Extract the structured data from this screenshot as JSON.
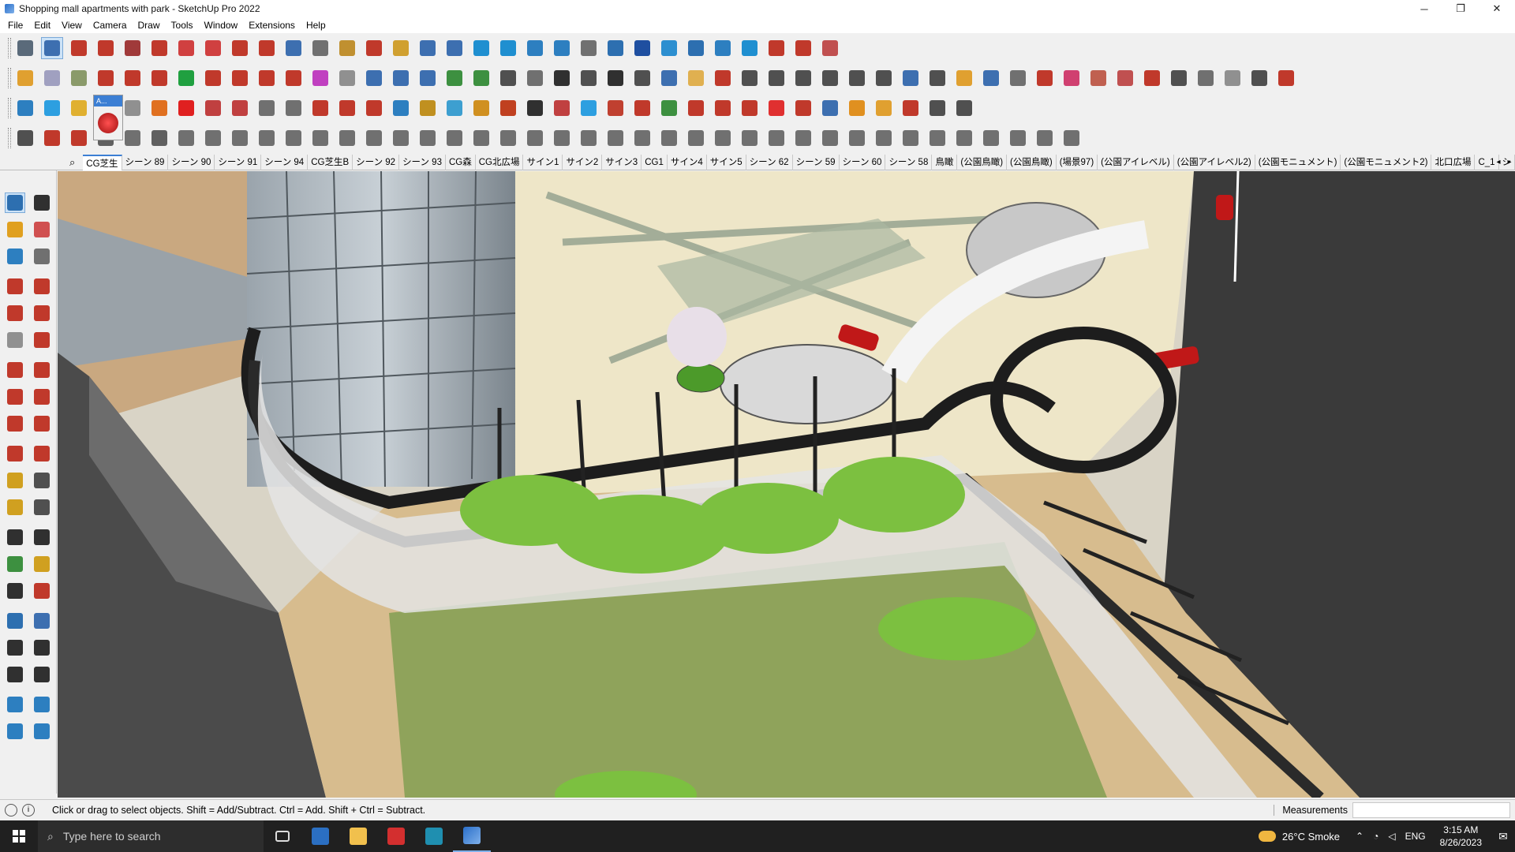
{
  "window": {
    "title": "Shopping mall apartments with park - SketchUp Pro 2022",
    "minimize": "─",
    "restore": "❐",
    "close": "✕"
  },
  "menu": [
    "File",
    "Edit",
    "View",
    "Camera",
    "Draw",
    "Tools",
    "Window",
    "Extensions",
    "Help"
  ],
  "toolbars": {
    "row1_colors": [
      "#5a6a7a",
      "#3d6fb0",
      "#c0392b",
      "#c0392b",
      "#a03a3a",
      "#c0392b",
      "#d04040",
      "#d04040",
      "#c0392b",
      "#c0392b",
      "#3d6fb0",
      "#707070",
      "#c09030",
      "#c0392b",
      "#d0a030",
      "#3d6fb0",
      "#3d6fb0",
      "#1f8fd0",
      "#1f8fd0",
      "#2d7fc0",
      "#2d7fc0",
      "#707070",
      "#2d6fb0",
      "#1f4fa0",
      "#2d8fd0",
      "#2d6fb0",
      "#2d7fc0",
      "#1f8fd0",
      "#c0392b",
      "#c0392b",
      "#c05050"
    ],
    "row2_colors": [
      "#e0a030",
      "#a0a0c0",
      "#8a9a6a",
      "#c0392b",
      "#c0392b",
      "#c0392b",
      "#20a040",
      "#c0392b",
      "#c0392b",
      "#c0392b",
      "#c0392b",
      "#c040c0",
      "#909090",
      "#3d6fb0",
      "#3d6fb0",
      "#3d6fb0",
      "#3d9040",
      "#3d9040",
      "#505050",
      "#707070",
      "#303030",
      "#505050",
      "#303030",
      "#505050",
      "#3d6fb0",
      "#e0b050",
      "#c0392b",
      "#505050",
      "#505050",
      "#505050",
      "#505050",
      "#505050",
      "#505050",
      "#3d6fb0",
      "#505050",
      "#e0a030",
      "#3d6fb0",
      "#707070",
      "#c0392b",
      "#d04070",
      "#c06050",
      "#c05050",
      "#c0392b",
      "#505050",
      "#707070",
      "#909090",
      "#505050",
      "#c0392b"
    ],
    "row3_colors": [
      "#2d7fc0",
      "#2d9fe0",
      "#e0b030",
      "#c0392b",
      "#909090",
      "#e07020",
      "#e02020",
      "#c04040",
      "#c04040",
      "#707070",
      "#707070",
      "#c0392b",
      "#c0392b",
      "#c0392b",
      "#2d7fc0",
      "#c09020",
      "#3d9fd0",
      "#d09020",
      "#c04020",
      "#303030",
      "#c04040",
      "#2d9fe0",
      "#c04030",
      "#c0392b",
      "#3d9040",
      "#c0392b",
      "#c0392b",
      "#c0392b",
      "#e03030",
      "#c0392b",
      "#3d6fb0",
      "#e09020",
      "#e0a030",
      "#c0392b",
      "#505050",
      "#505050"
    ],
    "row4_colors": [
      "#505050",
      "#c0392b",
      "#c0392b",
      "#606060",
      "#707070",
      "#606060",
      "#707070",
      "#707070",
      "#707070",
      "#707070",
      "#707070",
      "#707070",
      "#707070",
      "#707070",
      "#707070",
      "#707070",
      "#707070",
      "#707070",
      "#707070",
      "#707070",
      "#707070",
      "#707070",
      "#707070",
      "#707070",
      "#707070",
      "#707070",
      "#707070",
      "#707070",
      "#707070",
      "#707070",
      "#707070",
      "#707070",
      "#707070",
      "#707070",
      "#707070",
      "#707070",
      "#707070",
      "#707070",
      "#707070",
      "#707070"
    ],
    "floating_label": "A..."
  },
  "scenes": {
    "search_icon": "⌕",
    "tabs": [
      "CG芝生",
      "シーン 89",
      "シーン 90",
      "シーン 91",
      "シーン 94",
      "CG芝生B",
      "シーン 92",
      "シーン 93",
      "CG森",
      "CG北広場",
      "サイン1",
      "サイン2",
      "サイン3",
      "CG1",
      "サイン4",
      "サイン5",
      "シーン 62",
      "シーン 59",
      "シーン 60",
      "シーン 58",
      "鳥瞰",
      "(公園鳥瞰)",
      "(公園鳥瞰)",
      "(場景97)",
      "(公園アイレベル)",
      "(公園アイレベル2)",
      "(公園モニュメント)",
      "(公園モニュメント2)",
      "北口広場",
      "C_1",
      "シ"
    ],
    "active_index": 0,
    "arrow_left": "◂",
    "arrow_right": "▸"
  },
  "palette_colors": [
    "#2d6fb0",
    "#303030",
    "#e0a020",
    "#d05050",
    "#2d7fc0",
    "#707070",
    "#c0392b",
    "#c0392b",
    "#c0392b",
    "#c0392b",
    "#909090",
    "#c0392b",
    "#c0392b",
    "#c0392b",
    "#c0392b",
    "#c0392b",
    "#c0392b",
    "#c0392b",
    "#c0392b",
    "#c0392b",
    "#d0a020",
    "#505050",
    "#d0a020",
    "#505050",
    "#303030",
    "#303030",
    "#3d9040",
    "#d0a020",
    "#303030",
    "#c0392b",
    "#2d6fb0",
    "#3d6fb0",
    "#303030",
    "#303030",
    "#303030",
    "#303030",
    "#2d7fc0",
    "#2d7fc0",
    "#2d7fc0",
    "#2d7fc0"
  ],
  "status": {
    "hint": "Click or drag to select objects. Shift = Add/Subtract. Ctrl = Add. Shift + Ctrl = Subtract.",
    "info_icon": "i",
    "measurements_label": "Measurements",
    "measurements_value": ""
  },
  "taskbar": {
    "search_placeholder": "Type here to search",
    "weather": "26°C  Smoke",
    "lang": "ENG",
    "time": "3:15 AM",
    "date": "8/26/2023",
    "tray_up": "⌃",
    "notif_icon": "✉"
  }
}
